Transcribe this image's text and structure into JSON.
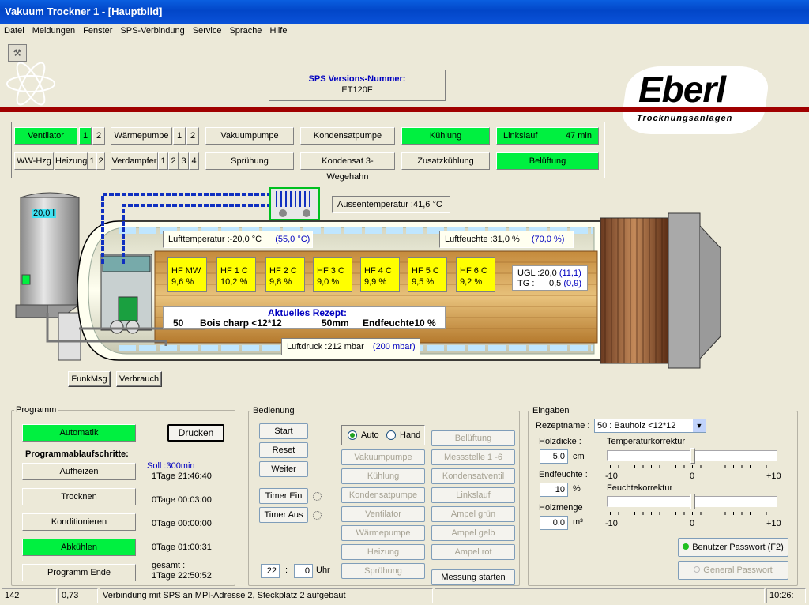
{
  "window": {
    "title": "Vakuum Trockner 1 - [Hauptbild]"
  },
  "menu": [
    "Datei",
    "Meldungen",
    "Fenster",
    "SPS-Verbindung",
    "Service",
    "Sprache",
    "Hilfe"
  ],
  "sps": {
    "label": "SPS Versions-Nummer:",
    "value": "ET120F"
  },
  "logo": {
    "name": "Eberl",
    "tagline": "Trocknungsanlagen",
    "accent": "#c00000"
  },
  "status_row1": {
    "ventilator": "Ventilator",
    "v1": "1",
    "v2": "2",
    "waermepumpe": "Wärmepumpe",
    "w1": "1",
    "w2": "2",
    "vakuumpumpe": "Vakuumpumpe",
    "kondensatpumpe": "Kondensatpumpe",
    "kuehlung": "Kühlung",
    "linkslauf": "Linkslauf",
    "linkslauf_time": "47 min"
  },
  "status_row2": {
    "wwhzg": "WW-Hzg",
    "heizung": "Heizung",
    "h1": "1",
    "h2": "2",
    "verdampfer": "Verdampfer",
    "d1": "1",
    "d2": "2",
    "d3": "3",
    "d4": "4",
    "spruehung": "Sprühung",
    "kondensat3": "Kondensat 3-Wegehahn",
    "zusatzkuehlung": "Zusatzkühlung",
    "belueftung": "Belüftung"
  },
  "process": {
    "tank_value": "20,0 l",
    "aussentemp": "Aussentemperatur :41,6  °C",
    "lufttemp": "Lufttemperatur :-20,0 °C",
    "lufttemp_soll": "(55,0  °C)",
    "luftfeuchte": "Luftfeuchte :31,0  %",
    "luftfeuchte_soll": "(70,0  %)",
    "sensors": [
      {
        "name": "HF MW",
        "value": "9,6  %"
      },
      {
        "name": "HF 1 C",
        "value": "10,2  %"
      },
      {
        "name": "HF 2 C",
        "value": "9,8  %"
      },
      {
        "name": "HF 3 C",
        "value": "9,0  %"
      },
      {
        "name": "HF 4 C",
        "value": "9,9  %"
      },
      {
        "name": "HF 5 C",
        "value": "9,5  %"
      },
      {
        "name": "HF 6 C",
        "value": "9,2  %"
      }
    ],
    "ugl_label": "UGL :",
    "ugl_value": "20,0",
    "ugl_soll": "(11,1)",
    "tg_label": "TG :",
    "tg_value": "0,5",
    "tg_soll": "(0,9)",
    "rezept_title": "Aktuelles Rezept:",
    "rezept_nr": "50",
    "rezept_name": "Bois charp <12*12",
    "rezept_dicke": "50mm",
    "rezept_end": "Endfeuchte10 %",
    "luftdruck": "Luftdruck :212  mbar",
    "luftdruck_soll": "(200 mbar)"
  },
  "buttons_top": {
    "funkmsg": "FunkMsg",
    "verbrauch": "Verbrauch"
  },
  "programm": {
    "title": "Programm",
    "automatik": "Automatik",
    "drucken": "Drucken",
    "schritte": "Programmablaufschritte:",
    "soll": "Soll :300min",
    "steps": [
      {
        "label": "Aufheizen",
        "time": "1Tage 21:46:40"
      },
      {
        "label": "Trocknen",
        "time": "0Tage 00:03:00"
      },
      {
        "label": "Konditionieren",
        "time": "0Tage 00:00:00"
      },
      {
        "label": "Abkühlen",
        "time": "0Tage 01:00:31"
      },
      {
        "label": "Programm Ende",
        "time": "1Tage 22:50:52"
      }
    ],
    "gesamt": "gesamt :"
  },
  "bedienung": {
    "title": "Bedienung",
    "start": "Start",
    "reset": "Reset",
    "weiter": "Weiter",
    "timer_ein": "Timer Ein",
    "timer_aus": "Timer Aus",
    "auto": "Auto",
    "hand": "Hand",
    "col1": [
      "Vakuumpumpe",
      "Kühlung",
      "Kondensatpumpe",
      "Ventilator",
      "Wärmepumpe",
      "Heizung",
      "Sprühung"
    ],
    "col2": [
      "Belüftung",
      "Messstelle 1 -6",
      "Kondensatventil",
      "Linkslauf",
      "Ampel grün",
      "Ampel gelb",
      "Ampel rot"
    ],
    "messung": "Messung starten",
    "hour": "22",
    "minute": "0",
    "uhr": "Uhr"
  },
  "eingaben": {
    "title": "Eingaben",
    "rezeptname_label": "Rezeptname :",
    "rezeptname_value": "50 : Bauholz <12*12",
    "holzdicke_label": "Holzdicke :",
    "holzdicke_value": "5,0",
    "holzdicke_unit": "cm",
    "endfeuchte_label": "Endfeuchte :",
    "endfeuchte_value": "10",
    "endfeuchte_unit": "%",
    "holzmenge_label": "Holzmenge",
    "holzmenge_value": "0,0",
    "holzmenge_unit": "m³",
    "tempkorr": "Temperaturkorrektur",
    "feuchtkorr": "Feuchtekorrektur",
    "scale_min": "-10",
    "scale_mid": "0",
    "scale_max": "+10",
    "benutzer": "Benutzer Passwort (F2)",
    "general": "General Passwort"
  },
  "statusbar": {
    "a": "142",
    "b": "0,73",
    "c": "Verbindung mit SPS an MPI-Adresse 2, Steckplatz 2 aufgebaut",
    "time": "10:26:"
  }
}
